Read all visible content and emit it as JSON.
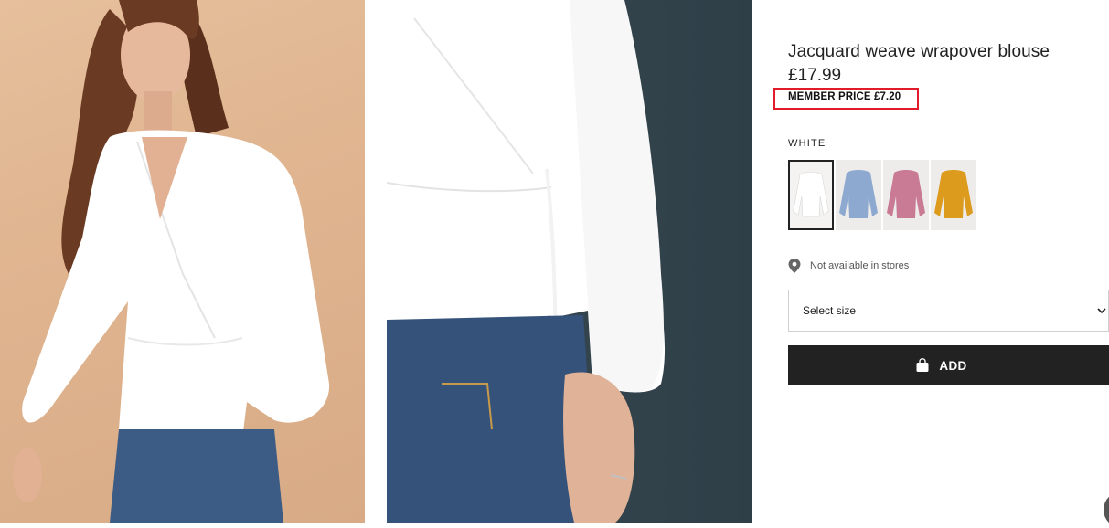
{
  "product": {
    "title": "Jacquard weave wrapover blouse",
    "price": "£17.99",
    "member_price": "MEMBER PRICE £7.20",
    "color_name": "WHITE",
    "swatches": [
      {
        "color": "#ffffff",
        "selected": true
      },
      {
        "color": "#8ea9cf",
        "selected": false
      },
      {
        "color": "#c97b95",
        "selected": false
      },
      {
        "color": "#dc9b1c",
        "selected": false
      }
    ]
  },
  "availability": {
    "icon": "location-pin-icon",
    "text": "Not available in stores"
  },
  "size_select": {
    "label": "Select size",
    "icon": "chevron-down-icon"
  },
  "add_button": {
    "label": "ADD",
    "icon": "shopping-bag-icon"
  },
  "colors": {
    "highlight_border": "#e21b2b",
    "button_bg": "#222222"
  }
}
